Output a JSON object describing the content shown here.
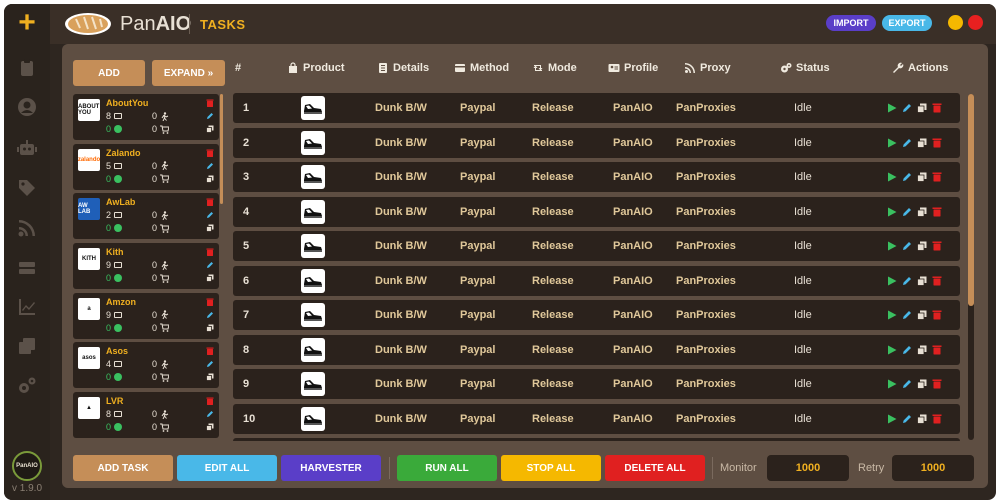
{
  "app": {
    "brand_prefix": "Pan",
    "brand_suffix": "AIO",
    "page_title": "TASKS",
    "import_label": "IMPORT",
    "export_label": "EXPORT",
    "version": "v 1.9.0",
    "logo_text": "PanAIO"
  },
  "colors": {
    "accent": "#f0b020",
    "panel": "#5e4e42",
    "row": "#2b221c",
    "import": "#5a3ec8",
    "export": "#49b8e8"
  },
  "sidebar": {
    "icons": [
      "plus-icon",
      "clipboard-icon",
      "user-icon",
      "robot-icon",
      "tag-icon",
      "rss-icon",
      "server-icon",
      "chart-line-icon",
      "copy-icon",
      "gears-icon"
    ]
  },
  "toolbar": {
    "add_label": "ADD",
    "expand_label": "EXPAND »"
  },
  "sites": [
    {
      "name": "AboutYou",
      "logo": "ABOUT YOU",
      "logo_bg": "#ffffff",
      "logo_fg": "#111111",
      "tasks": "8",
      "running": "0",
      "success": "0",
      "carted": "0"
    },
    {
      "name": "Zalando",
      "logo": "zalando",
      "logo_bg": "#ffffff",
      "logo_fg": "#ff6900",
      "tasks": "5",
      "running": "0",
      "success": "0",
      "carted": "0"
    },
    {
      "name": "AwLab",
      "logo": "AW LAB",
      "logo_bg": "#1f5fb8",
      "logo_fg": "#ffffff",
      "tasks": "2",
      "running": "0",
      "success": "0",
      "carted": "0"
    },
    {
      "name": "Kith",
      "logo": "KITH",
      "logo_bg": "#ffffff",
      "logo_fg": "#111111",
      "tasks": "9",
      "running": "0",
      "success": "0",
      "carted": "0"
    },
    {
      "name": "Amzon",
      "logo": "a",
      "logo_bg": "#ffffff",
      "logo_fg": "#111111",
      "tasks": "9",
      "running": "0",
      "success": "0",
      "carted": "0"
    },
    {
      "name": "Asos",
      "logo": "asos",
      "logo_bg": "#ffffff",
      "logo_fg": "#111111",
      "tasks": "4",
      "running": "0",
      "success": "0",
      "carted": "0"
    },
    {
      "name": "LVR",
      "logo": "▲",
      "logo_bg": "#ffffff",
      "logo_fg": "#111111",
      "tasks": "8",
      "running": "0",
      "success": "0",
      "carted": "0"
    }
  ],
  "table": {
    "headers": {
      "num": "#",
      "product": "Product",
      "details": "Details",
      "method": "Method",
      "mode": "Mode",
      "profile": "Profile",
      "proxy": "Proxy",
      "status": "Status",
      "actions": "Actions"
    },
    "rows": [
      {
        "num": "1",
        "details": "Dunk B/W",
        "method": "Paypal",
        "mode": "Release",
        "profile": "PanAIO",
        "proxy": "PanProxies",
        "status": "Idle"
      },
      {
        "num": "2",
        "details": "Dunk B/W",
        "method": "Paypal",
        "mode": "Release",
        "profile": "PanAIO",
        "proxy": "PanProxies",
        "status": "Idle"
      },
      {
        "num": "3",
        "details": "Dunk B/W",
        "method": "Paypal",
        "mode": "Release",
        "profile": "PanAIO",
        "proxy": "PanProxies",
        "status": "Idle"
      },
      {
        "num": "4",
        "details": "Dunk B/W",
        "method": "Paypal",
        "mode": "Release",
        "profile": "PanAIO",
        "proxy": "PanProxies",
        "status": "Idle"
      },
      {
        "num": "5",
        "details": "Dunk B/W",
        "method": "Paypal",
        "mode": "Release",
        "profile": "PanAIO",
        "proxy": "PanProxies",
        "status": "Idle"
      },
      {
        "num": "6",
        "details": "Dunk B/W",
        "method": "Paypal",
        "mode": "Release",
        "profile": "PanAIO",
        "proxy": "PanProxies",
        "status": "Idle"
      },
      {
        "num": "7",
        "details": "Dunk B/W",
        "method": "Paypal",
        "mode": "Release",
        "profile": "PanAIO",
        "proxy": "PanProxies",
        "status": "Idle"
      },
      {
        "num": "8",
        "details": "Dunk B/W",
        "method": "Paypal",
        "mode": "Release",
        "profile": "PanAIO",
        "proxy": "PanProxies",
        "status": "Idle"
      },
      {
        "num": "9",
        "details": "Dunk B/W",
        "method": "Paypal",
        "mode": "Release",
        "profile": "PanAIO",
        "proxy": "PanProxies",
        "status": "Idle"
      },
      {
        "num": "10",
        "details": "Dunk B/W",
        "method": "Paypal",
        "mode": "Release",
        "profile": "PanAIO",
        "proxy": "PanProxies",
        "status": "Idle"
      }
    ]
  },
  "footer": {
    "add_task": "ADD TASK",
    "edit_all": "EDIT ALL",
    "harvester": "HARVESTER",
    "run_all": "RUN ALL",
    "stop_all": "STOP ALL",
    "delete_all": "DELETE ALL",
    "monitor_label": "Monitor",
    "monitor_value": "1000",
    "retry_label": "Retry",
    "retry_value": "1000"
  }
}
